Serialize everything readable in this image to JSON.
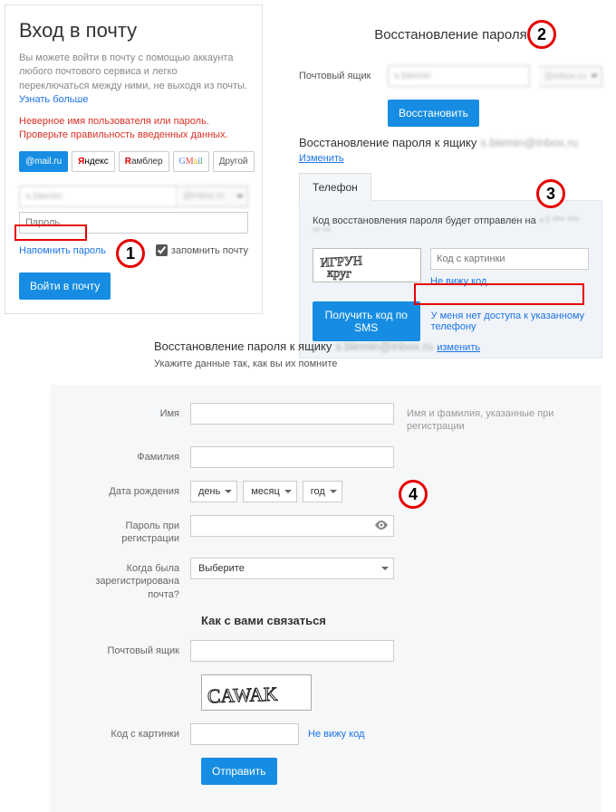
{
  "login": {
    "title": "Вход в почту",
    "intro_pre": "Вы можете войти в почту с помощью аккаунта любого почтового сервиса и легко переключаться между ними, не выходя из почты. ",
    "learn_more": "Узнать больше",
    "error": "Неверное имя пользователя или пароль. Проверьте правильность введенных данных.",
    "providers": {
      "mailru": "@mail.ru",
      "yandex": "Яндекс",
      "rambler": "Рамблер",
      "gmail": "GMail",
      "other": "Другой"
    },
    "user_value": "s.blemin",
    "domain_value": "@inbox.ru",
    "password_placeholder": "Пароль",
    "remind": "Напомнить пароль",
    "remember": "запомнить почту",
    "submit": "Войти в почту"
  },
  "step2": {
    "title": "Восстановление пароля",
    "label": "Почтовый ящик",
    "user_value": "s.blemin",
    "domain_value": "@inbox.ru",
    "button": "Восстановить"
  },
  "step3": {
    "title_prefix": "Восстановление пароля к ящику",
    "mailbox": "s.blemin@inbox.ru",
    "change": "Изменить",
    "tab": "Телефон",
    "info_pre": "Код восстановления пароля будет отправлен на ",
    "phone_masked": "+7 *** *** ** **",
    "captcha_placeholder": "Код с картинки",
    "cant_see": "Не вижу код",
    "get_code": "Получить код по SMS",
    "no_access": "У меня нет доступа к указанному телефону"
  },
  "step4head": {
    "title_prefix": "Восстановление пароля к ящику",
    "mailbox": "s.blemin@inbox.ru",
    "change": "изменить",
    "sub": "Укажите данные так, как вы их помните"
  },
  "step4": {
    "name_label": "Имя",
    "name_hint": "Имя и фамилия, указанные при регистрации",
    "surname_label": "Фамилия",
    "dob_label": "Дата рождения",
    "dob_day": "день",
    "dob_month": "месяц",
    "dob_year": "год",
    "reg_pw_label": "Пароль при регистрации",
    "reg_when_label": "Когда была зарегистрирована почта?",
    "reg_when_sel": "Выберите",
    "contact_header": "Как с вами связаться",
    "contact_mail_label": "Почтовый ящик",
    "code_label": "Код с картинки",
    "cant_see": "Не вижу код",
    "submit": "Отправить"
  },
  "annotations": {
    "s1": "1",
    "s2": "2",
    "s3": "3",
    "s4": "4"
  }
}
